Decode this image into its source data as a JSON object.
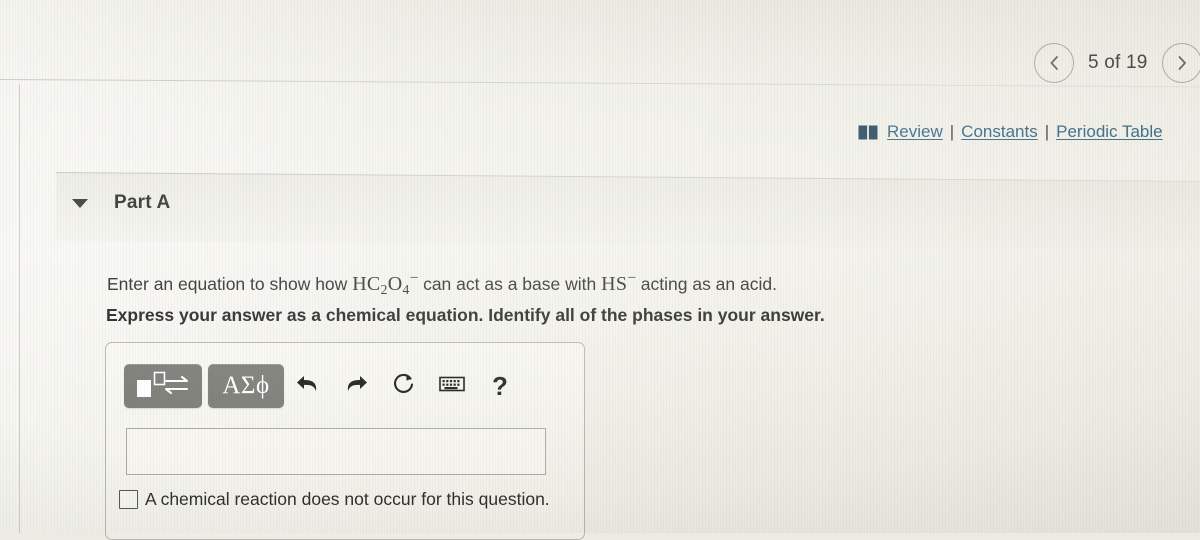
{
  "pager": {
    "prev_icon": "chevron-left-icon",
    "next_icon": "chevron-right-icon",
    "label": "5 of 19",
    "current": 5,
    "total": 19
  },
  "resources": {
    "book_icon": "book-icon",
    "review_label": "Review",
    "separator": "|",
    "constants_label": "Constants",
    "periodic_table_label": "Periodic Table",
    "link_color": "#3b6b84"
  },
  "part": {
    "caret_icon": "caret-down-icon",
    "title": "Part A"
  },
  "question": {
    "prompt_prefix": "Enter an equation to show how",
    "formula_1": {
      "lead": "HC",
      "sub_1": "2",
      "mid": "O",
      "sub_2": "4",
      "charge": "–"
    },
    "prompt_middle": "can act as a base with",
    "formula_2": {
      "lead": "HS",
      "charge": "–"
    },
    "prompt_suffix": "acting as an acid.",
    "instruction": "Express your answer as a chemical equation. Identify all of the phases in your answer."
  },
  "answer_panel": {
    "toolbar": {
      "template_button": "template-equilibrium-icon",
      "greek_button": "ΑΣϕ",
      "undo_icon": "undo-icon",
      "redo_icon": "redo-icon",
      "reset_icon": "reset-icon",
      "keyboard_icon": "keyboard-icon",
      "help_label": "?"
    },
    "input_value": "",
    "input_placeholder": "",
    "no_reaction": {
      "checked": false,
      "label": "A chemical reaction does not occur for this question."
    }
  }
}
